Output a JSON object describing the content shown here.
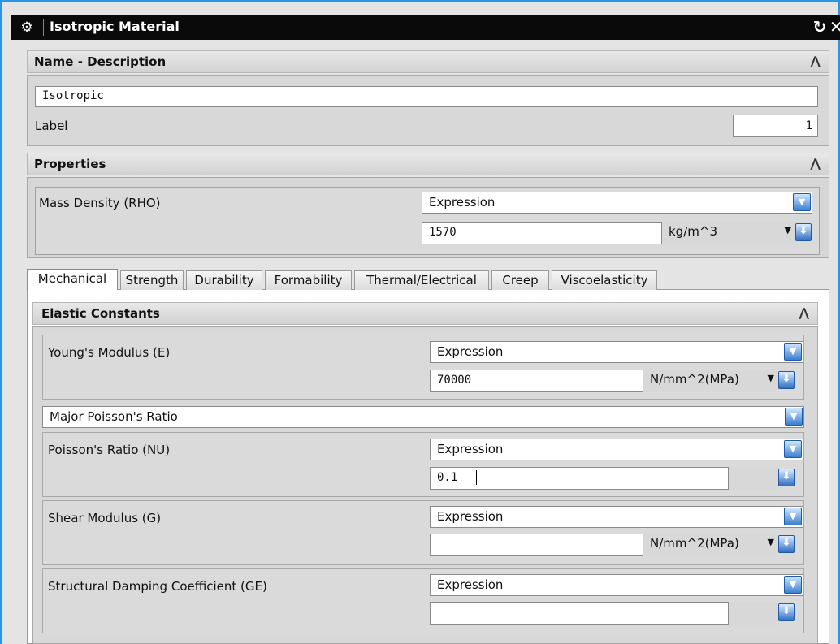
{
  "window": {
    "title": "Isotropic Material"
  },
  "name_description": {
    "header": "Name - Description",
    "name_value": "Isotropic",
    "label_label": "Label",
    "label_value": "1"
  },
  "properties": {
    "header": "Properties",
    "mass_density": {
      "label": "Mass Density (RHO)",
      "type": "Expression",
      "value": "1570",
      "unit": "kg/m^3"
    }
  },
  "tabs": [
    {
      "label": "Mechanical",
      "active": true
    },
    {
      "label": "Strength"
    },
    {
      "label": "Durability"
    },
    {
      "label": "Formability"
    },
    {
      "label": "Thermal/Electrical"
    },
    {
      "label": "Creep"
    },
    {
      "label": "Viscoelasticity"
    }
  ],
  "elastic": {
    "header": "Elastic Constants",
    "youngs": {
      "label": "Young's Modulus (E)",
      "type": "Expression",
      "value": "70000",
      "unit": "N/mm^2(MPa)"
    },
    "poisson_select": "Major Poisson's Ratio",
    "poisson": {
      "label": "Poisson's Ratio (NU)",
      "type": "Expression",
      "value": "0.1"
    },
    "shear": {
      "label": "Shear Modulus (G)",
      "type": "Expression",
      "value": "",
      "unit": "N/mm^2(MPa)"
    },
    "damping": {
      "label": "Structural Damping Coefficient (GE)",
      "type": "Expression",
      "value": ""
    }
  },
  "icons": {
    "gear": "⚙",
    "reset": "↻",
    "close": "✕",
    "collapse": "⋀",
    "dropdown": "▼",
    "down_arrow": "⬇"
  },
  "colors": {
    "frame": "#2a97e6",
    "titlebar": "#0a0a0a",
    "dropdown_blue": "#3a7fd0"
  }
}
